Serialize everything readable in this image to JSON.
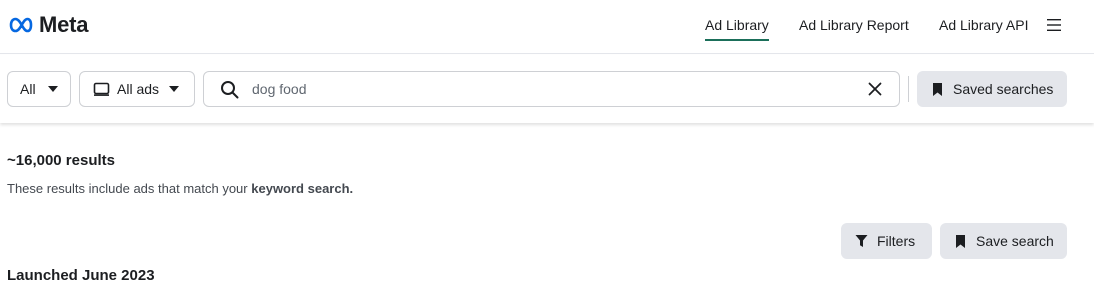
{
  "header": {
    "logo_text": "Meta",
    "nav": [
      {
        "label": "Ad Library",
        "active": true
      },
      {
        "label": "Ad Library Report",
        "active": false
      },
      {
        "label": "Ad Library API",
        "active": false
      }
    ],
    "menu_icon": "hamburger-icon"
  },
  "toolbar": {
    "country_select": "All",
    "ad_type_select": "All ads",
    "search": {
      "value": "dog food",
      "placeholder": "",
      "icon": "search-icon",
      "clear_icon": "close-icon"
    },
    "saved_searches_label": "Saved searches",
    "saved_searches_icon": "bookmark-icon"
  },
  "results": {
    "count": "~16,000 results",
    "description_prefix": "These results include ads that match your",
    "description_bold": "keyword search.",
    "filters_label": "Filters",
    "filters_icon": "funnel-icon",
    "save_search_label": "Save search",
    "save_search_icon": "bookmark-icon"
  },
  "section": {
    "title": "Launched June 2023"
  },
  "colors": {
    "meta_blue": "#0668E1",
    "active_underline": "#1b6f5a",
    "button_grey": "#e4e6eb",
    "border": "#ced0d4"
  }
}
